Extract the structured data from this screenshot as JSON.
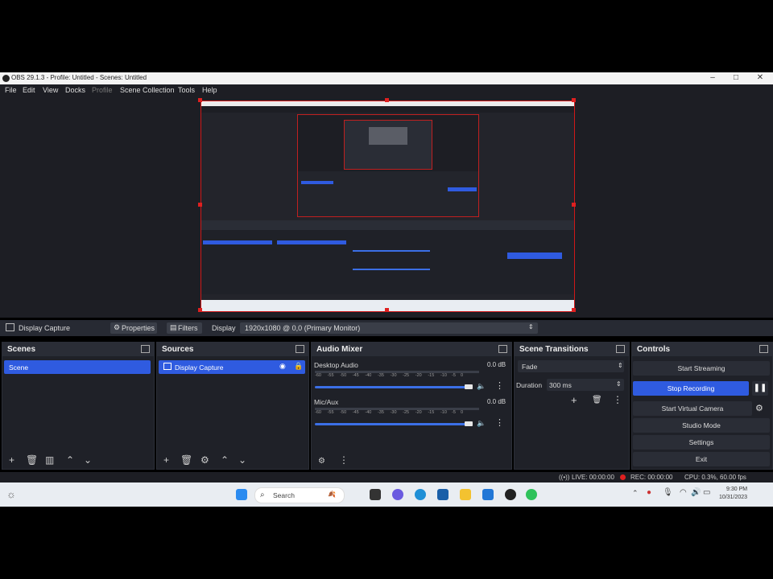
{
  "window": {
    "title": "OBS 29.1.3 - Profile: Untitled - Scenes: Untitled",
    "min": "–",
    "max": "□",
    "close": "✕"
  },
  "menu": [
    "File",
    "Edit",
    "View",
    "Docks",
    "Profile",
    "Scene Collection",
    "Tools",
    "Help"
  ],
  "source_toolbar": {
    "source_name": "Display Capture",
    "properties": "Properties",
    "filters": "Filters",
    "display_label": "Display",
    "display_value": "1920x1080 @ 0,0 (Primary Monitor)"
  },
  "scenes": {
    "title": "Scenes",
    "items": [
      "Scene"
    ]
  },
  "sources": {
    "title": "Sources",
    "items": [
      "Display Capture"
    ]
  },
  "audio_mixer": {
    "title": "Audio Mixer",
    "channels": [
      {
        "name": "Desktop Audio",
        "db": "0.0 dB"
      },
      {
        "name": "Mic/Aux",
        "db": "0.0 dB"
      }
    ],
    "ticks": [
      "-60",
      "-55",
      "-50",
      "-45",
      "-40",
      "-35",
      "-30",
      "-25",
      "-20",
      "-15",
      "-10",
      "-5",
      "0"
    ]
  },
  "scene_transitions": {
    "title": "Scene Transitions",
    "transition": "Fade",
    "duration_label": "Duration",
    "duration_value": "300 ms"
  },
  "controls": {
    "title": "Controls",
    "buttons": [
      "Start Streaming",
      "Stop Recording",
      "Start Virtual Camera",
      "Studio Mode",
      "Settings",
      "Exit"
    ]
  },
  "status": {
    "live": "LIVE: 00:00:00",
    "rec": "REC: 00:00:00",
    "cpu": "CPU: 0.3%, 60.00 fps"
  },
  "taskbar": {
    "search_placeholder": "Search",
    "time": "9:30 PM",
    "date": "10/31/2023"
  },
  "colors": {
    "accent": "#2f5be0",
    "rec_red": "#e02020",
    "bg": "#1d1e24"
  }
}
